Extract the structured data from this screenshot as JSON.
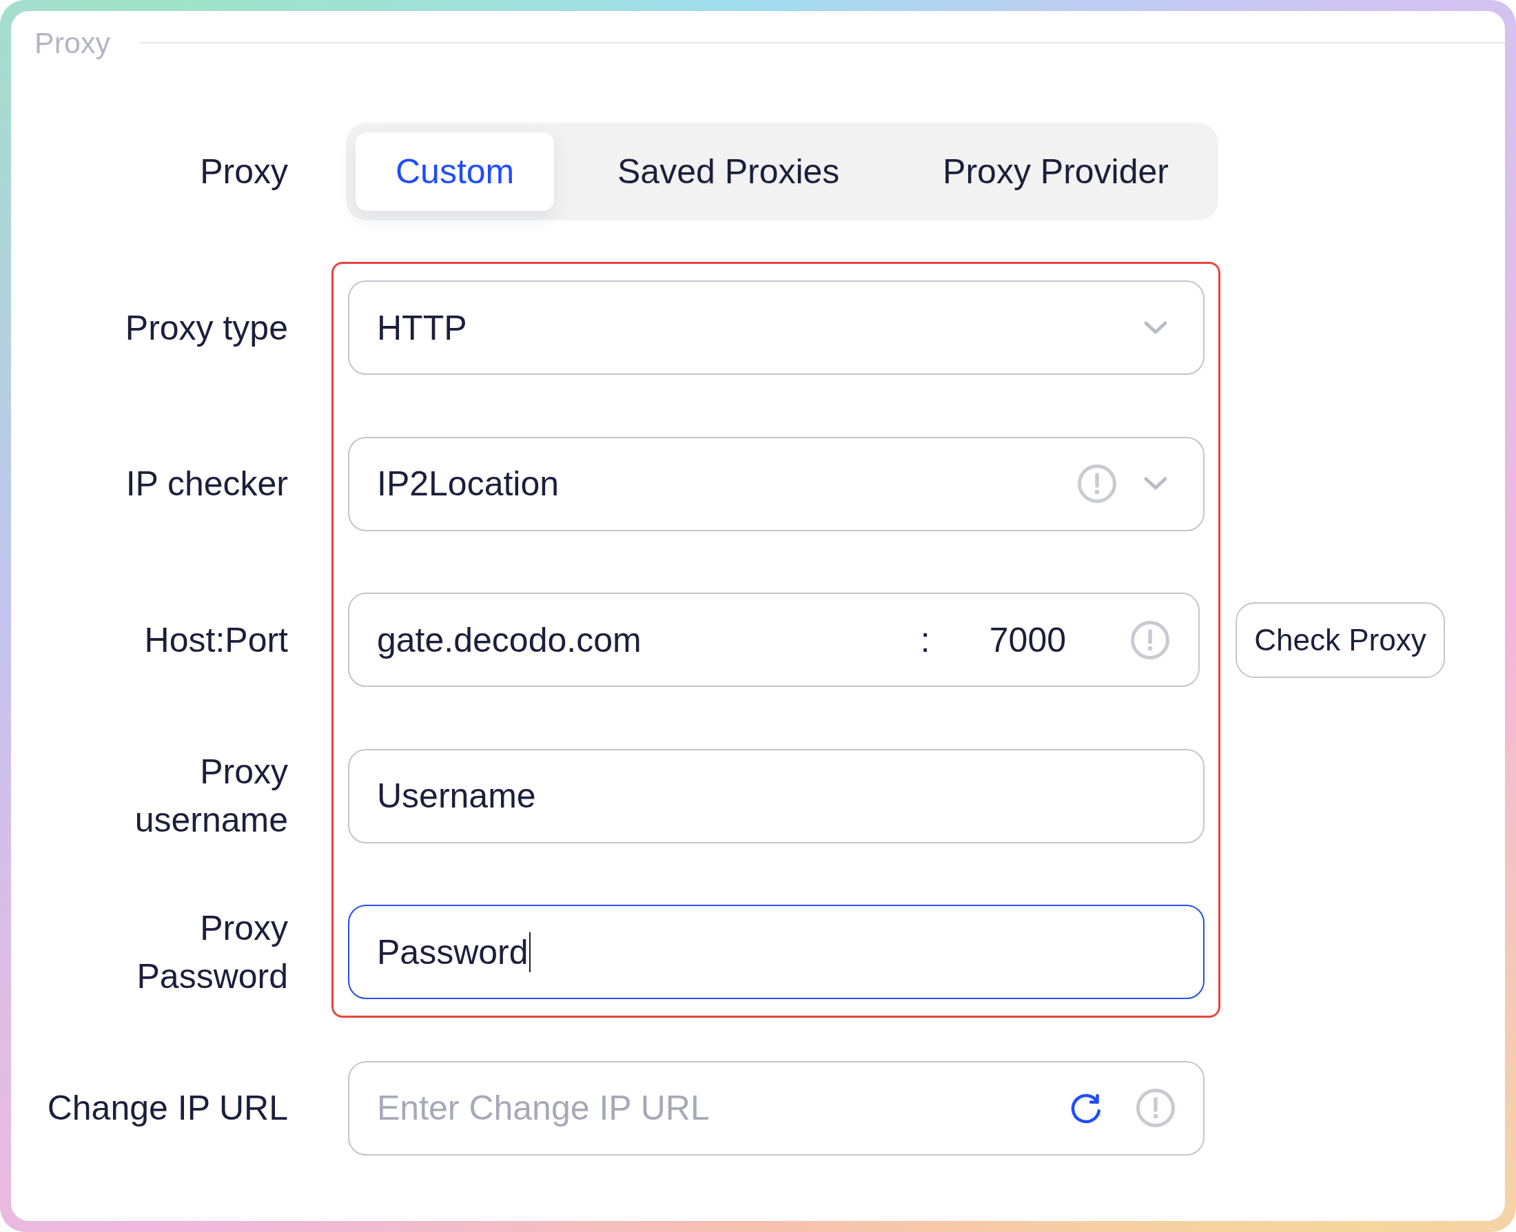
{
  "section": {
    "title": "Proxy"
  },
  "proxy_source": {
    "label": "Proxy",
    "tabs": [
      {
        "label": "Custom",
        "selected": true
      },
      {
        "label": "Saved Proxies",
        "selected": false
      },
      {
        "label": "Proxy Provider",
        "selected": false
      }
    ]
  },
  "fields": [
    {
      "kind": "select",
      "label": "Proxy type",
      "value": "HTTP",
      "info": false,
      "highlighted": true
    },
    {
      "kind": "select",
      "label": "IP checker",
      "value": "IP2Location",
      "info": true,
      "highlighted": true
    },
    {
      "kind": "host_port",
      "label": "Host:Port",
      "host": "gate.decodo.com",
      "separator": ":",
      "port": "7000",
      "info": true,
      "button": "Check Proxy",
      "highlighted": true
    },
    {
      "kind": "text",
      "label": "Proxy username",
      "value": "Username",
      "focused": false,
      "highlighted": true
    },
    {
      "kind": "text",
      "label": "Proxy Password",
      "value": "Password",
      "focused": true,
      "highlighted": true
    },
    {
      "kind": "url",
      "label": "Change IP URL",
      "placeholder": "Enter Change IP URL",
      "info": true,
      "highlighted": false
    }
  ]
}
